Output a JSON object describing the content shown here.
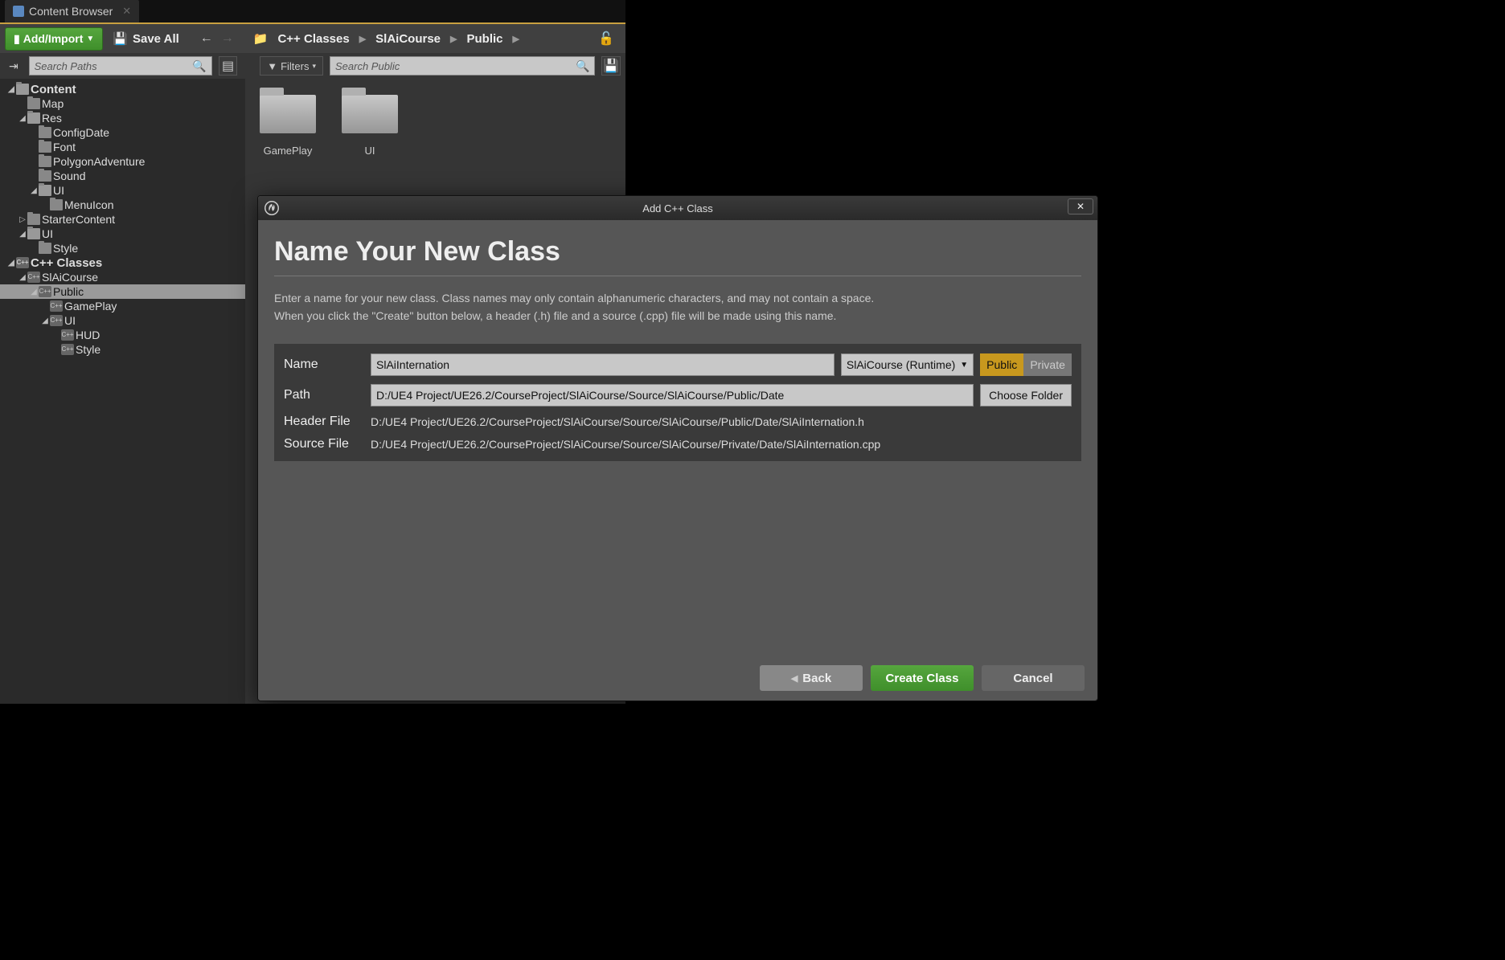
{
  "tab": {
    "title": "Content Browser"
  },
  "toolbar": {
    "add_import": "Add/Import",
    "save_all": "Save All",
    "breadcrumb": [
      "C++ Classes",
      "SlAiCourse",
      "Public"
    ]
  },
  "search": {
    "paths_placeholder": "Search Paths",
    "public_placeholder": "Search Public",
    "filters_label": "Filters"
  },
  "tree": {
    "content": "Content",
    "map": "Map",
    "res": "Res",
    "configdate": "ConfigDate",
    "font": "Font",
    "polygonadventure": "PolygonAdventure",
    "sound": "Sound",
    "ui1": "UI",
    "menuicon": "MenuIcon",
    "startercontent": "StarterContent",
    "ui2": "UI",
    "style": "Style",
    "cppclasses": "C++ Classes",
    "slaicourse": "SlAiCourse",
    "public": "Public",
    "gameplay": "GamePlay",
    "ui3": "UI",
    "hud": "HUD",
    "style2": "Style"
  },
  "tiles": {
    "gameplay": "GamePlay",
    "ui": "UI"
  },
  "dialog": {
    "title": "Add C++ Class",
    "heading": "Name Your New Class",
    "desc1": "Enter a name for your new class. Class names may only contain alphanumeric characters, and may not contain a space.",
    "desc2": "When you click the \"Create\" button below, a header (.h) file and a source (.cpp) file will be made using this name.",
    "name_label": "Name",
    "name_value": "SlAiInternation",
    "module_label": "SlAiCourse (Runtime)",
    "public_btn": "Public",
    "private_btn": "Private",
    "path_label": "Path",
    "path_value": "D:/UE4 Project/UE26.2/CourseProject/SlAiCourse/Source/SlAiCourse/Public/Date",
    "choose_folder": "Choose Folder",
    "header_label": "Header File",
    "header_value": "D:/UE4 Project/UE26.2/CourseProject/SlAiCourse/Source/SlAiCourse/Public/Date/SlAiInternation.h",
    "source_label": "Source File",
    "source_value": "D:/UE4 Project/UE26.2/CourseProject/SlAiCourse/Source/SlAiCourse/Private/Date/SlAiInternation.cpp",
    "back": "Back",
    "create": "Create Class",
    "cancel": "Cancel"
  }
}
